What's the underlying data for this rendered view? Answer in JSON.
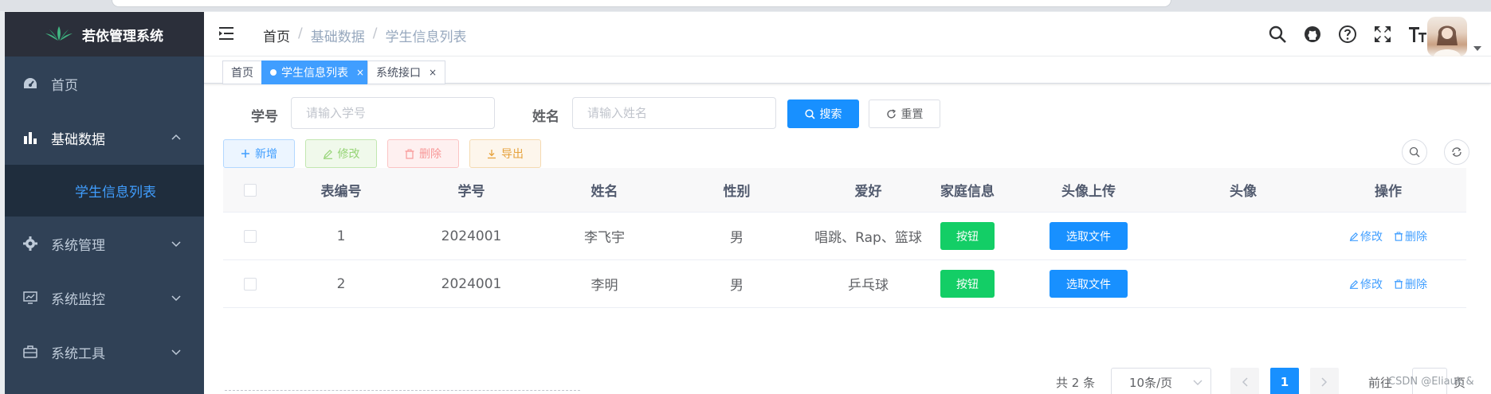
{
  "app": {
    "brand": "若依管理系统"
  },
  "sidebar": {
    "items": [
      {
        "label": "首页",
        "icon": "dashboard-icon"
      },
      {
        "label": "基础数据",
        "icon": "bar-chart-icon",
        "expanded": true
      },
      {
        "label": "系统管理",
        "icon": "gear-icon"
      },
      {
        "label": "系统监控",
        "icon": "monitor-icon"
      },
      {
        "label": "系统工具",
        "icon": "toolbox-icon"
      }
    ],
    "sub_item": "学生信息列表"
  },
  "breadcrumb": [
    "首页",
    "基础数据",
    "学生信息列表"
  ],
  "breadcrumb_sep": "/",
  "tags": [
    {
      "label": "首页",
      "active": false
    },
    {
      "label": "学生信息列表",
      "active": true
    },
    {
      "label": "系统接口",
      "active": false
    }
  ],
  "tag_close": "×",
  "search": {
    "no_label": "学号",
    "no_placeholder": "请输入学号",
    "name_label": "姓名",
    "name_placeholder": "请输入姓名",
    "search_btn": "搜索",
    "reset_btn": "重置"
  },
  "toolbar": {
    "add": "新增",
    "edit": "修改",
    "delete": "删除",
    "export": "导出"
  },
  "table": {
    "headers": [
      "表编号",
      "学号",
      "姓名",
      "性别",
      "爱好",
      "家庭信息",
      "头像上传",
      "头像",
      "操作"
    ],
    "rows": [
      {
        "id": "1",
        "no": "2024001",
        "name": "李飞宇",
        "gender": "男",
        "hobby": "唱跳、Rap、篮球",
        "family_btn": "按钮",
        "upload_btn": "选取文件",
        "edit": "修改",
        "delete": "删除"
      },
      {
        "id": "2",
        "no": "2024001",
        "name": "李明",
        "gender": "男",
        "hobby": "乒乓球",
        "family_btn": "按钮",
        "upload_btn": "选取文件",
        "edit": "修改",
        "delete": "删除"
      }
    ]
  },
  "pagination": {
    "total": "共 2 条",
    "page_size": "10条/页",
    "current": "1",
    "goto": "前往",
    "page_suffix": "页"
  },
  "watermark": "CSDN @Eliauk &",
  "colors": {
    "sidebar": "#304156",
    "primary": "#1890ff",
    "success": "#13ce66",
    "active_text": "#409eff"
  }
}
